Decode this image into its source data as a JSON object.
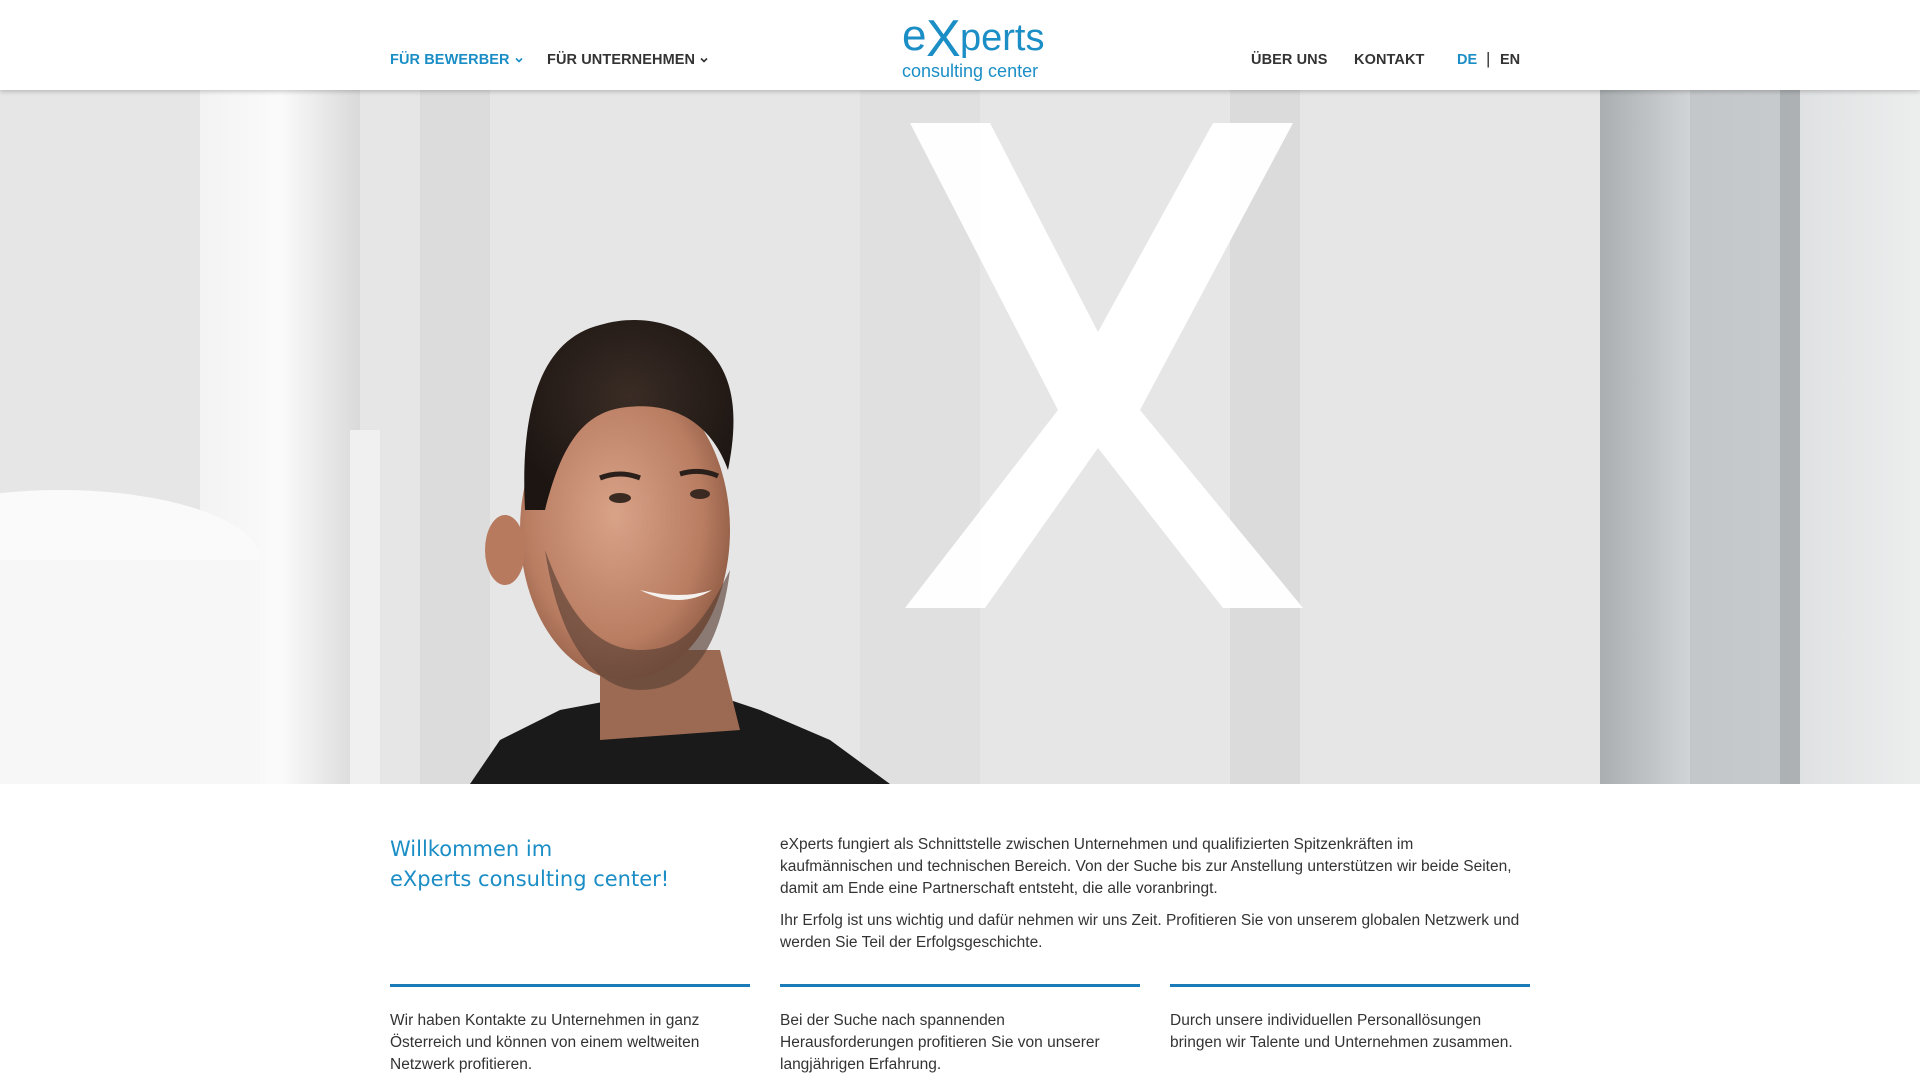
{
  "nav": {
    "left": [
      {
        "label": "FÜR BEWERBER",
        "icon": "chevron-down-icon",
        "active": true
      },
      {
        "label": "FÜR UNTERNEHMEN",
        "icon": "chevron-down-icon",
        "active": false
      }
    ],
    "right": [
      {
        "label": "ÜBER UNS"
      },
      {
        "label": "KONTAKT"
      }
    ],
    "languages": [
      {
        "label": "DE",
        "active": true
      },
      {
        "label": "EN",
        "active": false
      }
    ],
    "language_separator": "|"
  },
  "logo": {
    "word_prefix": "e",
    "word_x": "X",
    "word_suffix": "perts",
    "tagline": "consulting center",
    "color": "#1b8ec6"
  },
  "hero": {
    "image": "smiling-man-office-photo",
    "overlay_letter": "X"
  },
  "welcome": {
    "line1": "Willkommen im",
    "line2": "eXperts consulting center!"
  },
  "intro": {
    "p1": "eXperts fungiert als Schnittstelle zwischen Unternehmen und qualifizierten Spitzenkräften im kaufmännischen und technischen Bereich. Von der Suche bis zur Anstellung unterstützen wir beide Seiten, damit am Ende eine Partnerschaft entsteht, die alle voranbringt.",
    "p2": "Ihr Erfolg ist uns wichtig und dafür nehmen wir uns Zeit. Profitieren Sie von unserem globalen Netzwerk und werden Sie Teil der Erfolgsgeschichte."
  },
  "features": [
    {
      "text": "Wir haben Kontakte zu Unternehmen in ganz Österreich und können von einem weltweiten Netzwerk profitieren."
    },
    {
      "text": "Bei der Suche nach spannenden Herausforderungen profitieren Sie von unserer langjährigen Erfahrung."
    },
    {
      "text": "Durch unsere individuellen Personallösungen bringen wir Talente und Unternehmen zusammen."
    }
  ],
  "colors": {
    "accent": "#1b8ec6",
    "rule": "#1b7ab8",
    "text": "#333333"
  }
}
